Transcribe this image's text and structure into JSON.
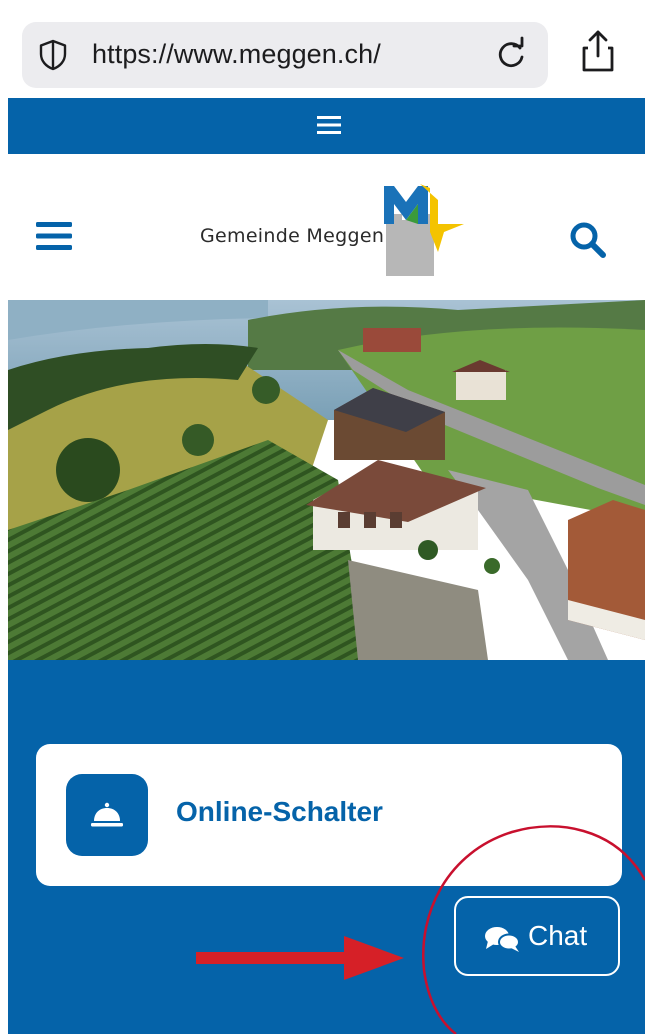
{
  "browser": {
    "url": "https://www.meggen.ch/",
    "lock_icon": "shield-icon",
    "reload_icon": "reload-icon",
    "share_icon": "share-icon"
  },
  "top_nav": {
    "menu_icon": "menu-icon"
  },
  "header": {
    "menu_icon": "hamburger-menu-icon",
    "brand_name": "Gemeinde Meggen",
    "logo": "meggen-logo",
    "search_icon": "search-icon"
  },
  "hero": {
    "image": "aerial-view-meggen"
  },
  "services": {
    "online_schalter_label": "Online-Schalter",
    "online_schalter_icon": "service-bell-icon"
  },
  "chat": {
    "label": "Chat",
    "icon": "chat-bubbles-icon"
  },
  "annotations": {
    "arrow_color": "#d62027",
    "circle_color": "#c8102e"
  },
  "colors": {
    "brand_blue": "#0563a9",
    "white": "#ffffff"
  }
}
